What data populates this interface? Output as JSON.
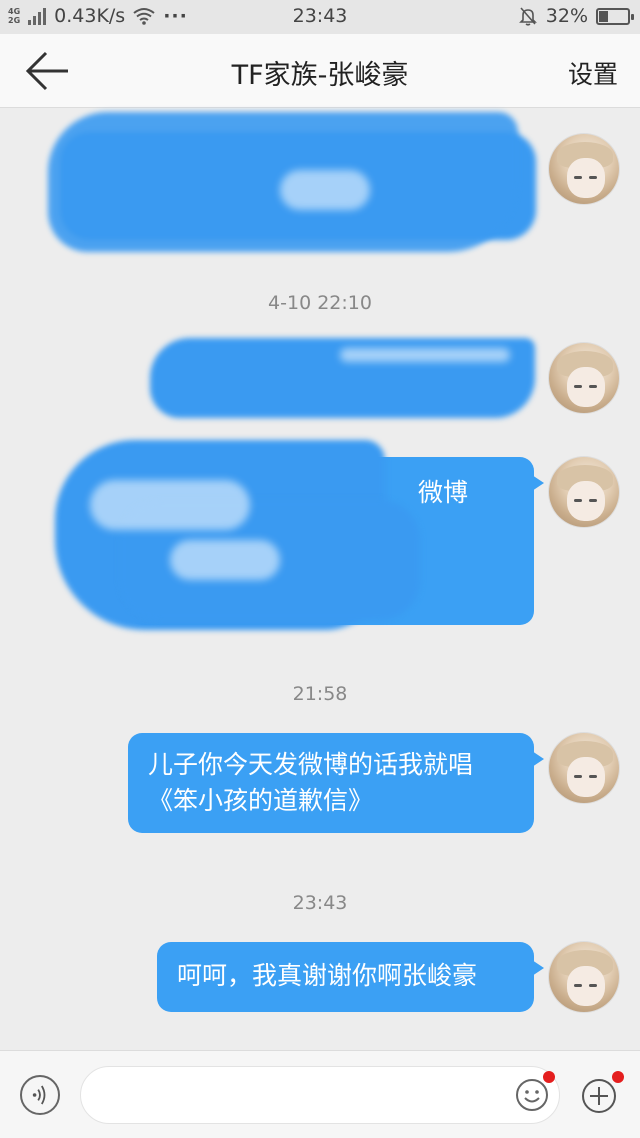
{
  "status_bar": {
    "network_type_top": "4G",
    "network_type_bottom": "2G",
    "speed": "0.43K/s",
    "more_dots": "···",
    "time": "23:43",
    "battery": "32%",
    "battery_level": 0.32,
    "icons": [
      "signal-icon",
      "wifi-icon",
      "mute-bell-icon",
      "battery-icon"
    ]
  },
  "header": {
    "title": "TF家族-张峻豪",
    "settings_label": "设置",
    "back_icon": "arrow-left-icon"
  },
  "messages": {
    "timestamps": [
      "4-10 22:10",
      "21:58",
      "23:43"
    ],
    "censored_fragment": "微博",
    "message_4": "儿子你今天发微博的话我就唱《笨小孩的道歉信》",
    "message_5": "呵呵，我真谢谢你啊张峻豪"
  },
  "input_bar": {
    "placeholder": "",
    "voice_icon": "voice-icon",
    "emoji_icon": "emoji-icon",
    "plus_icon": "plus-icon"
  },
  "colors": {
    "bubble": "#3ba0f4",
    "background": "#ededed",
    "badge": "#e41e1e"
  }
}
